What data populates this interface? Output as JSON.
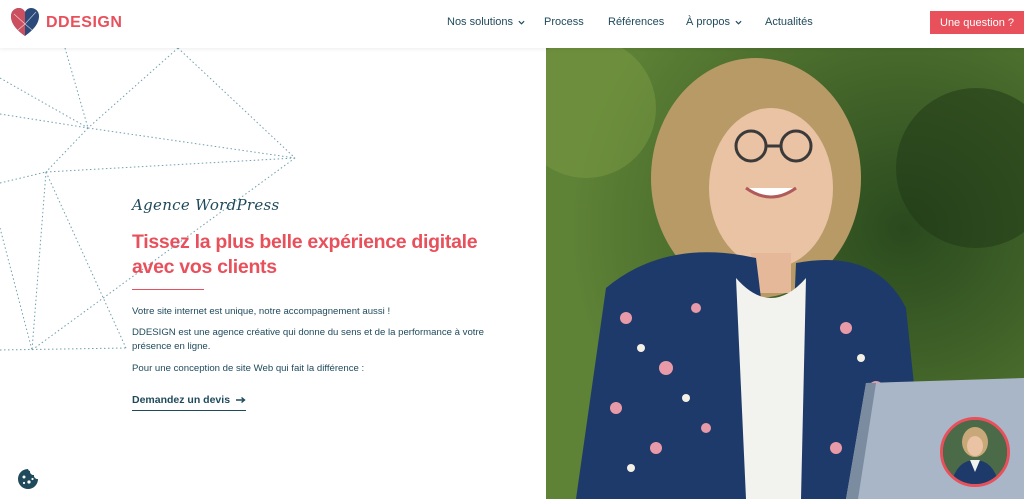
{
  "brand": {
    "name": "DDESIGN",
    "accent": "#e8505b",
    "text_color": "#1f4a5c"
  },
  "nav": {
    "items": [
      {
        "label": "Nos solutions",
        "has_dropdown": true
      },
      {
        "label": "Process",
        "has_dropdown": false
      },
      {
        "label": "Références",
        "has_dropdown": false
      },
      {
        "label": "À propos",
        "has_dropdown": true
      },
      {
        "label": "Actualités",
        "has_dropdown": false
      }
    ],
    "cta": "Une question ?"
  },
  "hero": {
    "tagline": "Agence WordPress",
    "headline": "Tissez la plus belle expérience digitale avec vos clients",
    "paragraphs": [
      "Votre site internet est unique, notre accompagnement aussi !",
      "DDESIGN est une agence créative qui donne du sens et de la performance à votre présence en ligne.",
      "Pour une conception de site Web qui fait la différence :"
    ],
    "link": "Demandez un devis"
  },
  "icons": {
    "logo": "heart-logo-icon",
    "dropdown": "chevron-down-icon",
    "link_arrow": "arrow-right-icon",
    "cookie": "cookie-icon",
    "chat_avatar": "avatar"
  }
}
